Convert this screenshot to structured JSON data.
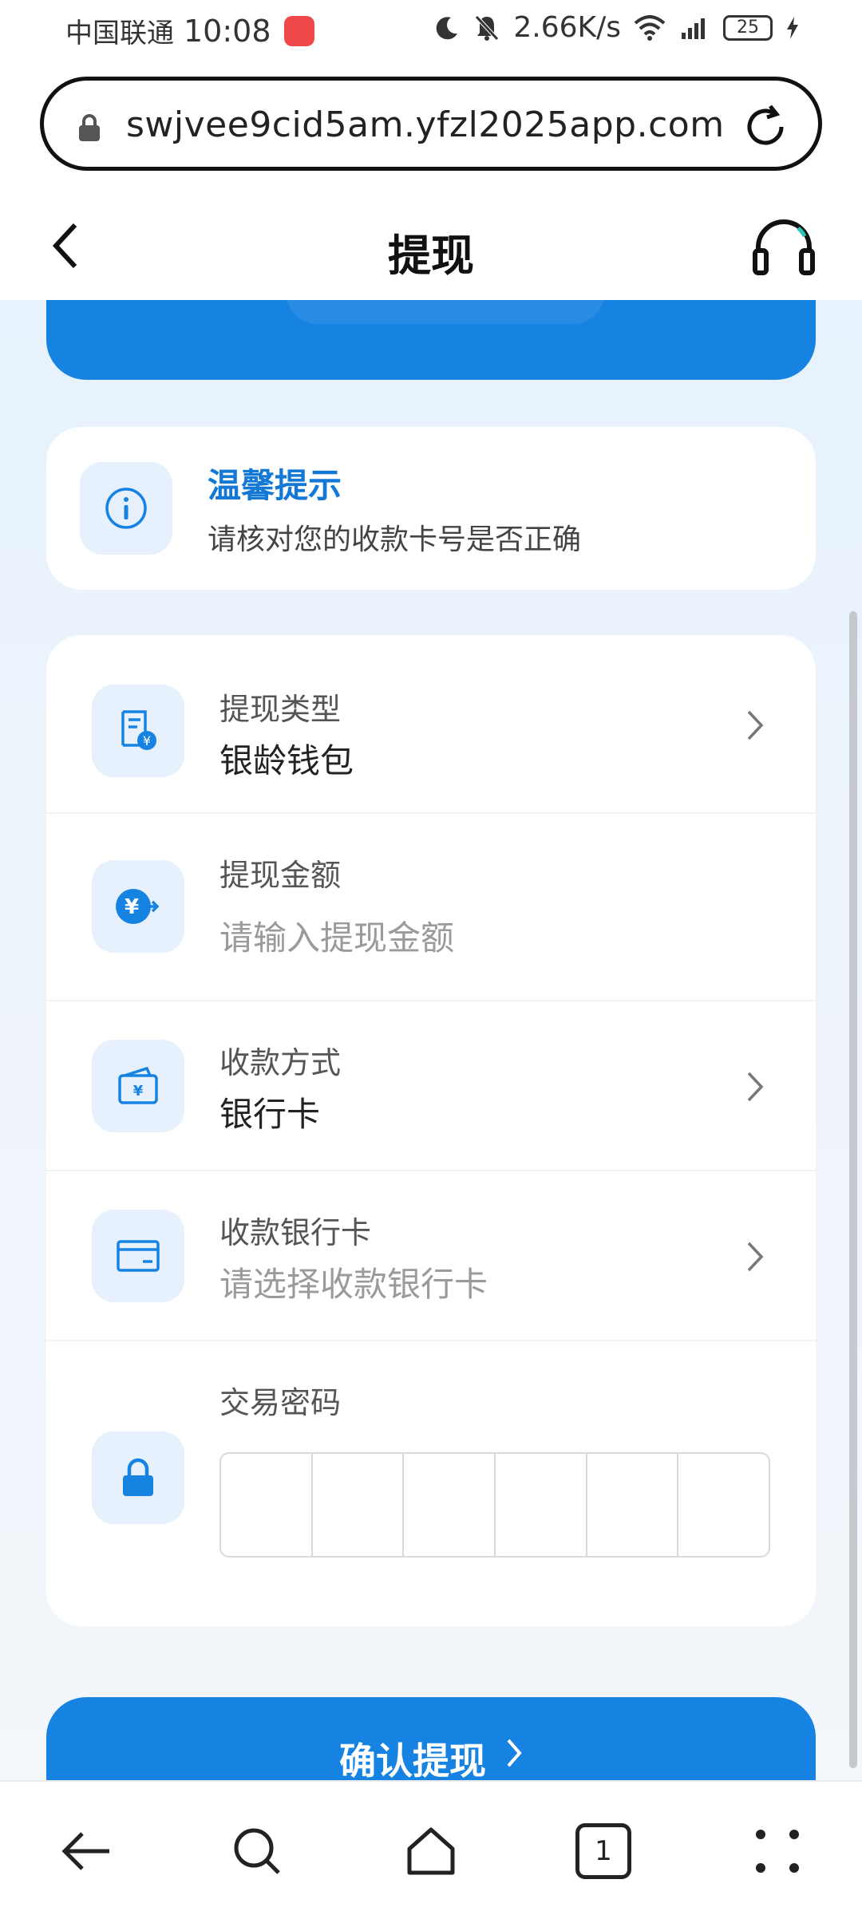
{
  "status_bar": {
    "carrier": "中国联通",
    "time": "10:08",
    "net_speed": "2.66K/s",
    "battery": "25"
  },
  "browser": {
    "url": "swjvee9cid5am.yfzl2025app.com"
  },
  "header": {
    "title": "提现"
  },
  "tip": {
    "title": "温馨提示",
    "text": "请核对您的收款卡号是否正确"
  },
  "form": {
    "withdraw_type": {
      "label": "提现类型",
      "value": "银龄钱包"
    },
    "amount": {
      "label": "提现金额",
      "placeholder": "请输入提现金额"
    },
    "method": {
      "label": "收款方式",
      "value": "银行卡"
    },
    "bank_card": {
      "label": "收款银行卡",
      "placeholder": "请选择收款银行卡"
    },
    "password": {
      "label": "交易密码"
    }
  },
  "confirm_label": "确认提现",
  "bottom_nav": {
    "tab_count": "1"
  },
  "colors": {
    "accent": "#1683e3",
    "tip_title": "#1479d6",
    "icon_bg": "#e6f1fd"
  }
}
